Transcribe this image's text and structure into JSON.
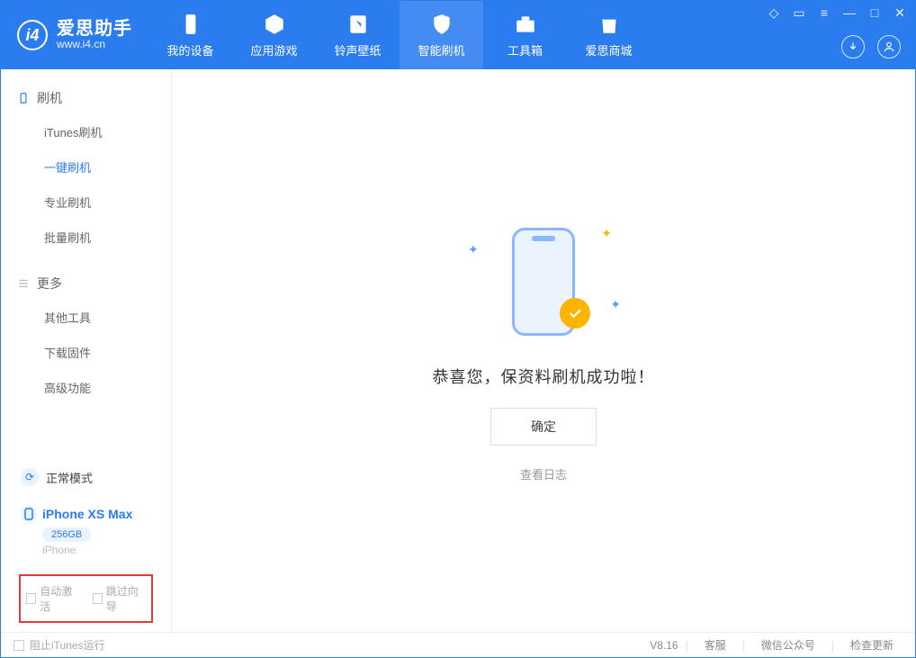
{
  "app": {
    "name": "爱思助手",
    "url": "www.i4.cn"
  },
  "nav": {
    "items": [
      {
        "label": "我的设备"
      },
      {
        "label": "应用游戏"
      },
      {
        "label": "铃声壁纸"
      },
      {
        "label": "智能刷机"
      },
      {
        "label": "工具箱"
      },
      {
        "label": "爱思商城"
      }
    ]
  },
  "sidebar": {
    "section1": {
      "title": "刷机",
      "items": [
        "iTunes刷机",
        "一键刷机",
        "专业刷机",
        "批量刷机"
      ]
    },
    "section2": {
      "title": "更多",
      "items": [
        "其他工具",
        "下载固件",
        "高级功能"
      ]
    },
    "mode": "正常模式",
    "device": {
      "name": "iPhone XS Max",
      "capacity": "256GB",
      "sub": "iPhone"
    },
    "checks": {
      "auto_activate": "自动激活",
      "skip_guide": "跳过向导"
    }
  },
  "main": {
    "message": "恭喜您，保资料刷机成功啦！",
    "ok_button": "确定",
    "view_log": "查看日志"
  },
  "status": {
    "block_itunes": "阻止iTunes运行",
    "version": "V8.16",
    "support": "客服",
    "wechat": "微信公众号",
    "update": "检查更新"
  }
}
